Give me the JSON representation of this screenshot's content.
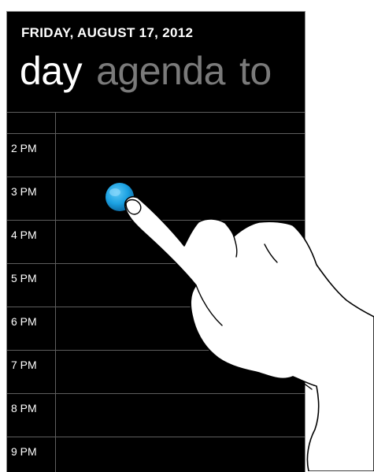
{
  "header": {
    "date": "FRIDAY, AUGUST 17, 2012"
  },
  "pivot": {
    "items": [
      {
        "label": "day",
        "active": true
      },
      {
        "label": "agenda",
        "active": false
      },
      {
        "label": "to",
        "active": false
      }
    ]
  },
  "timeline": {
    "hours": [
      "2 PM",
      "3 PM",
      "4 PM",
      "5 PM",
      "6 PM",
      "7 PM",
      "8 PM",
      "9 PM"
    ]
  },
  "colors": {
    "background": "#000000",
    "text": "#ffffff",
    "inactive_pivot": "#7a7a7a",
    "gridline": "#5e5e5e",
    "touch_indicator": "#1ba1e2"
  },
  "icons": {
    "gesture": "tap-gesture-hand-icon",
    "touch_point": "touch-point-icon"
  }
}
